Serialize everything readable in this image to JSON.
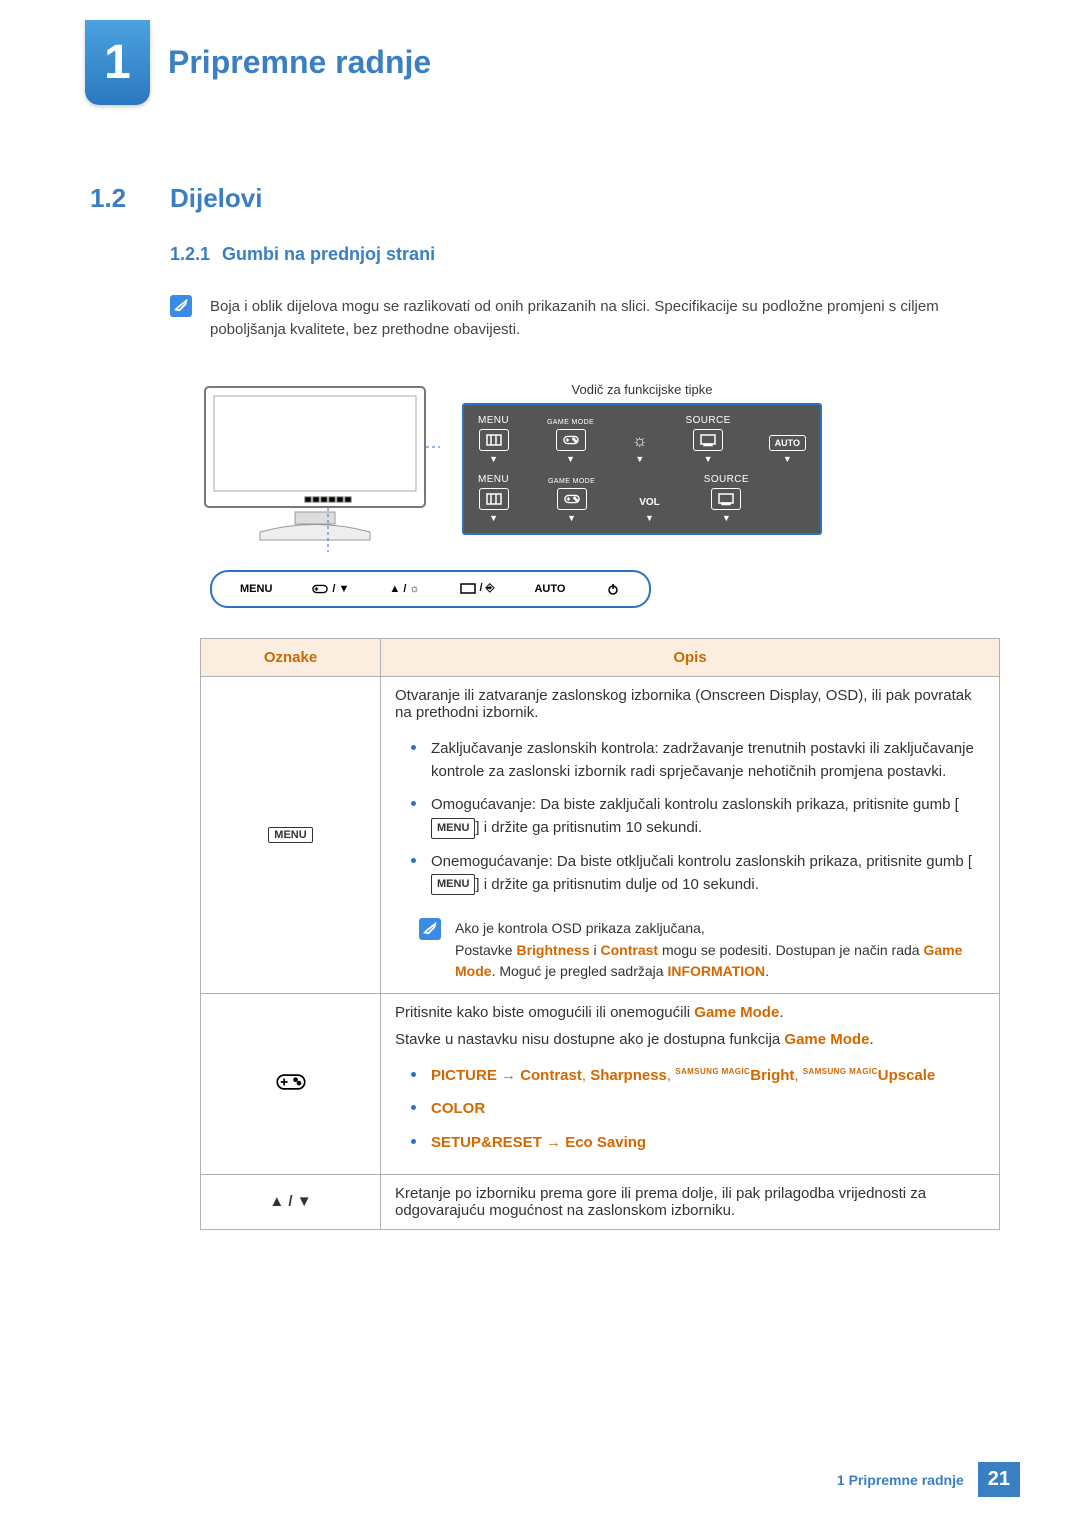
{
  "chapter": {
    "number": "1",
    "title": "Pripremne radnje"
  },
  "section": {
    "number": "1.2",
    "title": "Dijelovi"
  },
  "subsection": {
    "number": "1.2.1",
    "title": "Gumbi na prednjoj strani"
  },
  "note1": "Boja i oblik dijelova mogu se razlikovati od onih prikazanih na slici. Specifikacije su podložne promjeni s ciljem poboljšanja kvalitete, bez prethodne obavijesti.",
  "diagram": {
    "guide_label": "Vodič za funkcijske tipke",
    "row1": {
      "menu": "MENU",
      "game_mode": "GAME MODE",
      "source": "SOURCE",
      "auto": "AUTO"
    },
    "row2": {
      "menu": "MENU",
      "game_mode": "GAME MODE",
      "vol": "VOL",
      "source": "SOURCE"
    },
    "legend": {
      "menu": "MENU",
      "auto": "AUTO"
    }
  },
  "table": {
    "headers": {
      "col1": "Oznake",
      "col2": "Opis"
    },
    "row_menu": {
      "label": "MENU",
      "p1": "Otvaranje ili zatvaranje zaslonskog izbornika (Onscreen Display, OSD), ili pak povratak na prethodni izbornik.",
      "li1": "Zaključavanje zaslonskih kontrola: zadržavanje trenutnih postavki ili zaključavanje kontrole za zaslonski izbornik radi sprječavanje nehotičnih promjena postavki.",
      "li2a": "Omogućavanje: Da biste zaključali kontrolu zaslonskih prikaza, pritisnite gumb [",
      "li2b": "] i držite ga pritisnutim 10 sekundi.",
      "li3a": "Onemogućavanje: Da biste otključali kontrolu zaslonskih prikaza, pritisnite gumb [",
      "li3b": "] i držite ga pritisnutim dulje od 10 sekundi.",
      "menu_box": "MENU",
      "note_line1": "Ako je kontrola OSD prikaza zaključana,",
      "note_line2a": "Postavke ",
      "note_brightness": "Brightness",
      "note_and": " i ",
      "note_contrast": "Contrast",
      "note_line2b": " mogu se podesiti. Dostupan je način rada ",
      "note_gamemode": "Game Mode",
      "note_line2c": ". Moguć je pregled sadržaja ",
      "note_information": "INFORMATION",
      "note_line2d": "."
    },
    "row_game": {
      "p1a": "Pritisnite kako biste omogućili ili onemogućili ",
      "p1_gm": "Game Mode",
      "p1b": ".",
      "p2a": "Stavke u nastavku nisu dostupne ako je dostupna funkcija ",
      "p2_gm": "Game Mode",
      "p2b": ".",
      "li1_picture": "PICTURE",
      "li1_arrow": " → ",
      "li1_contrast": "Contrast",
      "li1_c1": ", ",
      "li1_sharp": "Sharpness",
      "li1_c2": ", ",
      "li1_bright": "Bright",
      "li1_c3": ", ",
      "li1_upscale": "Upscale",
      "li2_color": "COLOR",
      "li3_setup": "SETUP&RESET",
      "li3_arrow": " → ",
      "li3_eco": "Eco Saving",
      "magic": "SAMSUNG MAGIC"
    },
    "row_arrows": {
      "label": "▲ / ▼",
      "p1": "Kretanje po izborniku prema gore ili prema dolje, ili pak prilagodba vrijednosti za odgovarajuću mogućnost na zaslonskom izborniku."
    }
  },
  "footer": {
    "text": "1 Pripremne radnje",
    "page": "21"
  }
}
